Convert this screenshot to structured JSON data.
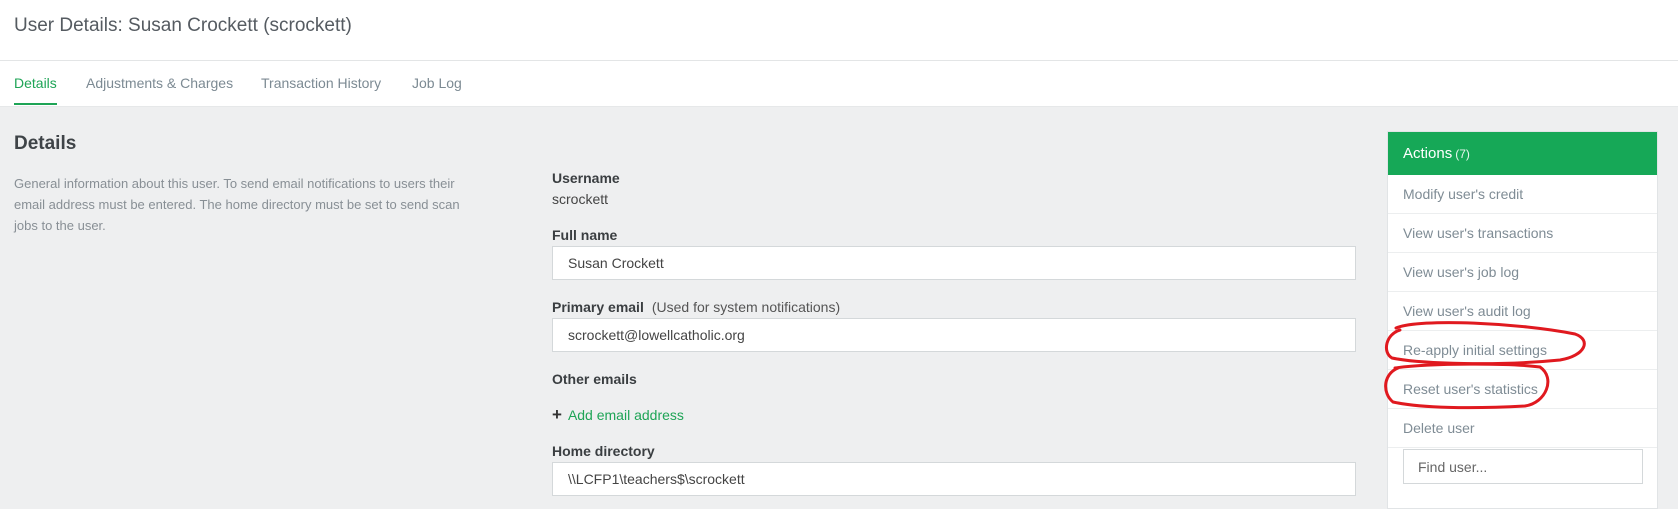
{
  "page": {
    "title": "User Details: Susan Crockett (scrockett)"
  },
  "tabs": [
    {
      "label": "Details",
      "active": true
    },
    {
      "label": "Adjustments & Charges",
      "active": false
    },
    {
      "label": "Transaction History",
      "active": false
    },
    {
      "label": "Job Log",
      "active": false
    }
  ],
  "details": {
    "title": "Details",
    "description": "General information about this user. To send email notifications to users their email address must be entered. The home directory must be set to send scan jobs to the user.",
    "username_label": "Username",
    "username_value": "scrockett",
    "fullname_label": "Full name",
    "fullname_value": "Susan Crockett",
    "email_label": "Primary email",
    "email_hint": "(Used for system notifications)",
    "email_value": "scrockett@lowellcatholic.org",
    "other_emails_label": "Other emails",
    "add_email_icon": "plus-icon",
    "add_email_label": "Add email address",
    "homedir_label": "Home directory",
    "homedir_value": "\\\\LCFP1\\teachers$\\scrockett"
  },
  "actions": {
    "title": "Actions",
    "count": "(7)",
    "items": [
      "Modify user's credit",
      "View user's transactions",
      "View user's job log",
      "View user's audit log",
      "Re-apply initial settings",
      "Reset user's statistics",
      "Delete user"
    ],
    "find_user_placeholder": "Find user..."
  },
  "colors": {
    "accent": "#1ea456",
    "actions_header": "#16a857",
    "annotation": "#e0191f"
  }
}
